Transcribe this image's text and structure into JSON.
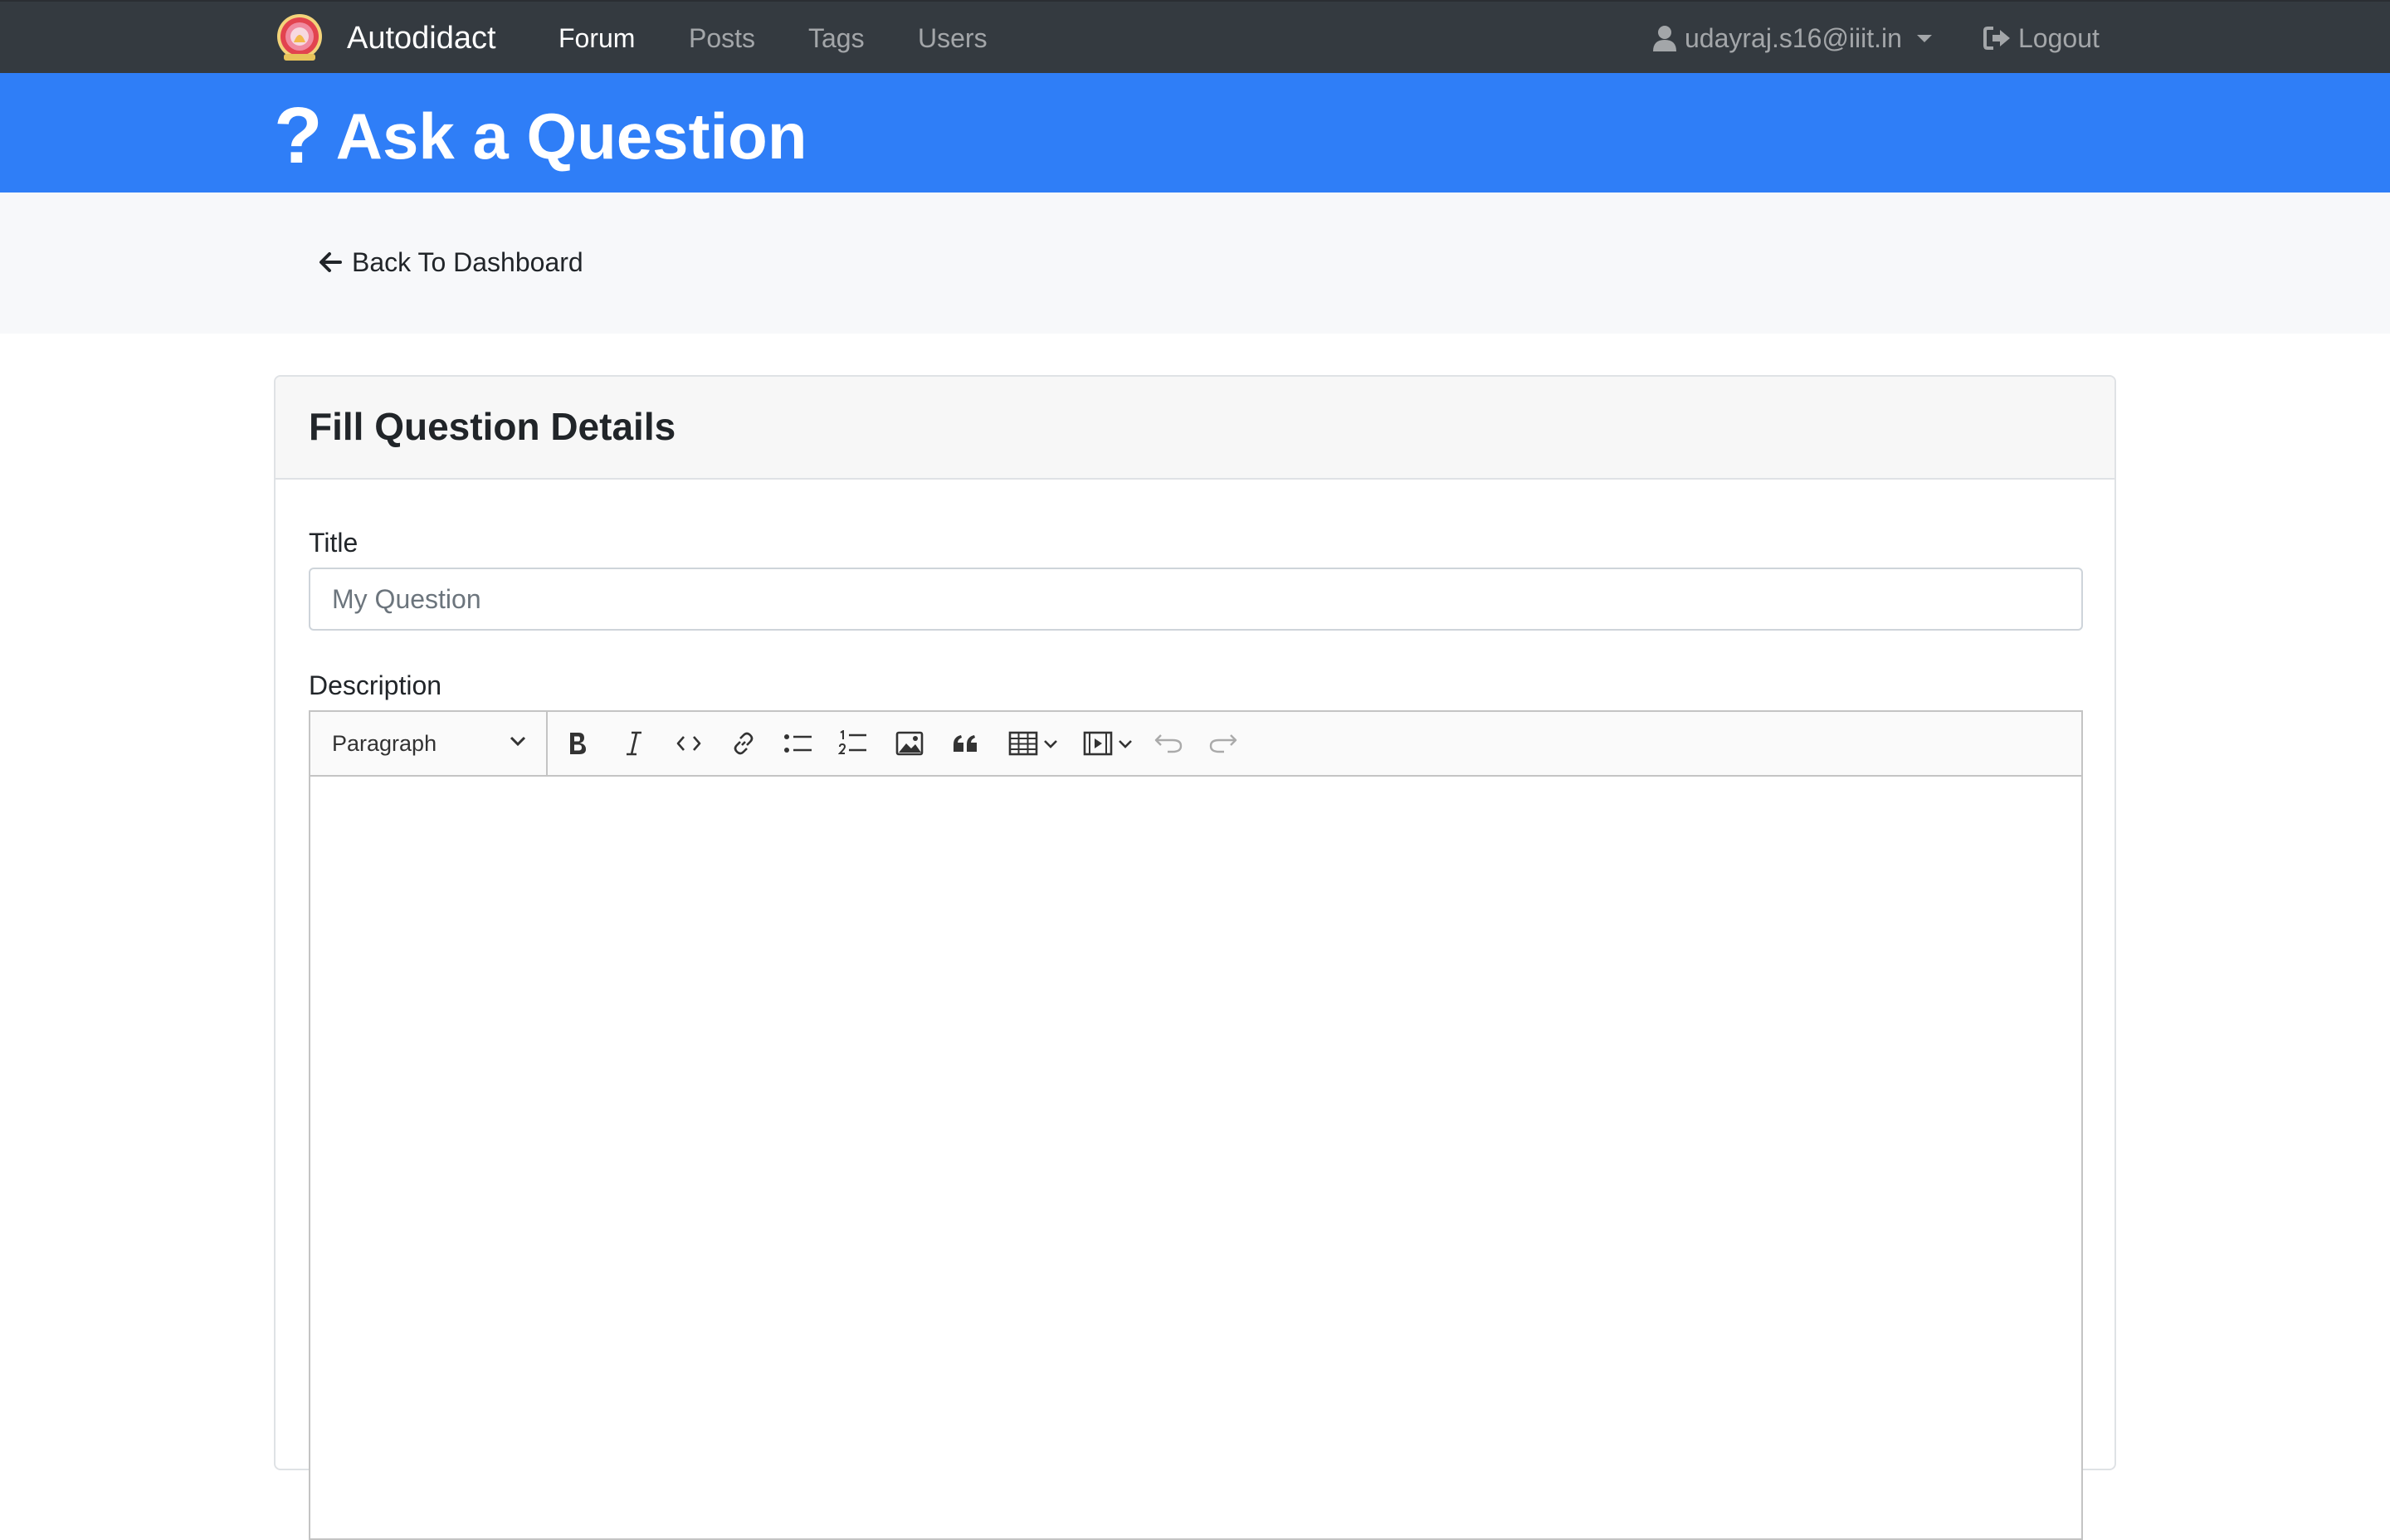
{
  "navbar": {
    "brand": "Autodidact",
    "links": [
      {
        "label": "Forum",
        "active": true
      },
      {
        "label": "Posts",
        "active": false
      },
      {
        "label": "Tags",
        "active": false
      },
      {
        "label": "Users",
        "active": false
      }
    ],
    "user": "udayraj.s16@iiit.in",
    "logout": "Logout"
  },
  "hero": {
    "icon": "?",
    "title": "Ask a Question"
  },
  "back_link": "Back To Dashboard",
  "card": {
    "title": "Fill Question Details",
    "title_field": {
      "label": "Title",
      "value": "",
      "placeholder": "My Question"
    },
    "description_field": {
      "label": "Description"
    },
    "editor": {
      "heading_select": "Paragraph",
      "toolbar_icons": [
        "bold-icon",
        "italic-icon",
        "code-icon",
        "link-icon",
        "bulleted-list-icon",
        "numbered-list-icon",
        "image-icon",
        "quote-icon",
        "table-icon",
        "media-icon",
        "undo-icon",
        "redo-icon"
      ],
      "content": ""
    }
  },
  "colors": {
    "navbar_bg": "#343a40",
    "hero_bg": "#2f7ef7",
    "subbar_bg": "#f7f8fa",
    "card_header_bg": "#f7f7f7"
  }
}
